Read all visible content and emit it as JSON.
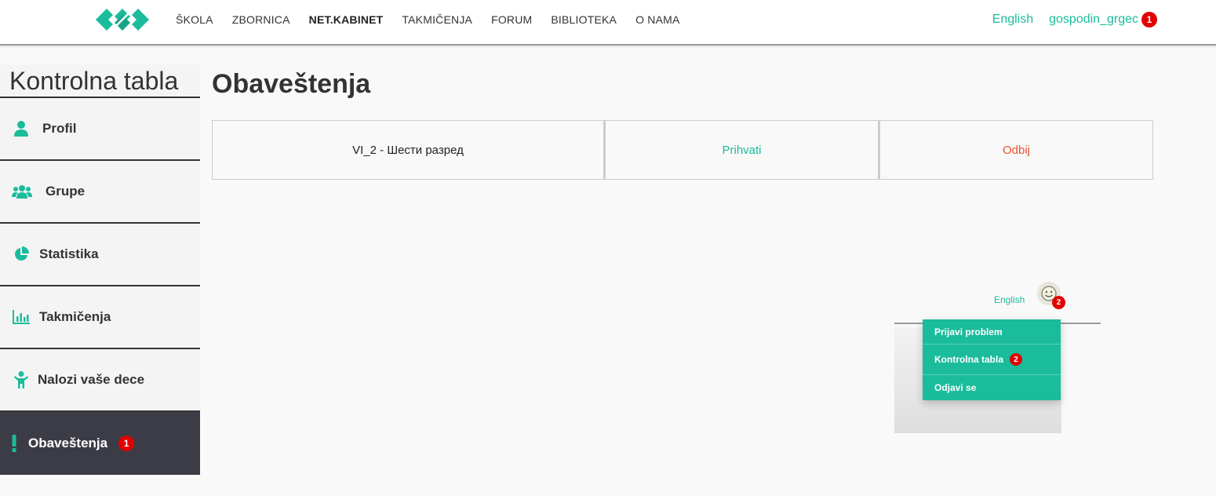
{
  "nav": {
    "items": [
      {
        "label": "ŠKOLA"
      },
      {
        "label": "ZBORNICA"
      },
      {
        "label": "NET.KABINET",
        "active": true
      },
      {
        "label": "TAKMIČENJA"
      },
      {
        "label": "FORUM"
      },
      {
        "label": "BIBLIOTEKA"
      },
      {
        "label": "O NAMA"
      }
    ],
    "language": "English",
    "username": "gospodin_grgec",
    "user_badge": "1"
  },
  "sidebar": {
    "title": "Kontrolna tabla",
    "items": [
      {
        "label": "Profil",
        "icon": "user-icon"
      },
      {
        "label": "Grupe",
        "icon": "users-icon"
      },
      {
        "label": "Statistika",
        "icon": "pie-chart-icon"
      },
      {
        "label": "Takmičenja",
        "icon": "bar-chart-icon"
      },
      {
        "label": "Nalozi vaše dece",
        "icon": "child-icon"
      },
      {
        "label": "Obaveštenja",
        "icon": "exclamation-icon",
        "badge": "1",
        "active": true
      }
    ]
  },
  "main": {
    "title": "Obaveštenja",
    "notifications": [
      {
        "group": "VI_2 - Шести разред",
        "accept": "Prihvati",
        "reject": "Odbij"
      }
    ]
  },
  "help": {
    "language": "English",
    "avatar_badge": "2",
    "menu": [
      {
        "label": "Prijavi problem"
      },
      {
        "label": "Kontrolna tabla",
        "badge": "2"
      },
      {
        "label": "Odjavi se"
      }
    ]
  },
  "colors": {
    "accent": "#1abc9c",
    "badge": "#e30000",
    "reject": "#e8522e",
    "active_sidebar": "#3c3c46"
  }
}
